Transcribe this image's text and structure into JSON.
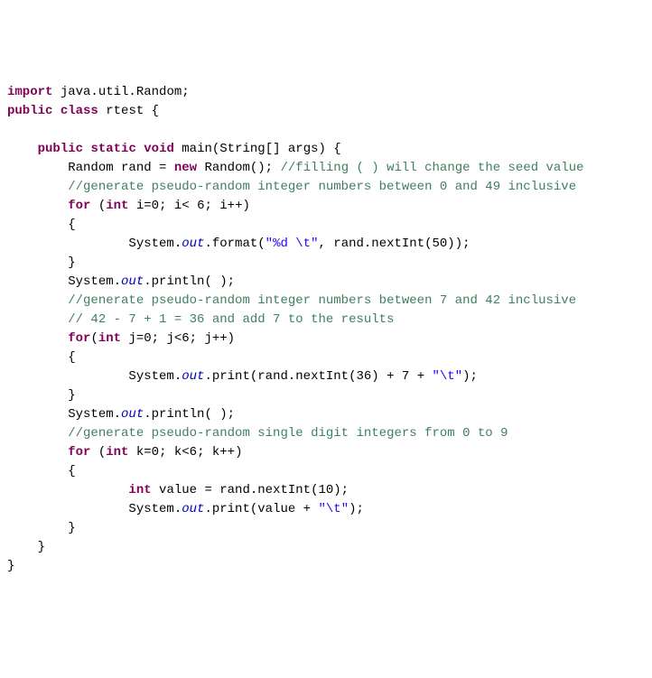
{
  "code": {
    "l1_import": "import",
    "l1_pkg": " java.util.Random;",
    "l2_public": "public",
    "l2_class": "class",
    "l2_name": " rtest {",
    "l4_public": "public",
    "l4_static": "static",
    "l4_void": "void",
    "l4_main": " main(String[] args) {",
    "l5_type": "Random rand = ",
    "l5_new": "new",
    "l5_rest": " Random(); ",
    "l5_cmt": "//filling ( ) will change the seed value",
    "l6_cmt": "//generate pseudo-random integer numbers between 0 and 49 inclusive",
    "l7_for": "for",
    "l7_rest": " (",
    "l7_int": "int",
    "l7_cond": " i=0; i< 6; i++)",
    "l8_brace": "{",
    "l9_sys": "System.",
    "l9_out": "out",
    "l9_format": ".format(",
    "l9_str": "\"%d \\t\"",
    "l9_rest": ", rand.nextInt(50));",
    "l10_brace": "}",
    "l11_sys": "System.",
    "l11_out": "out",
    "l11_println": ".println( );",
    "l12_cmt": "//generate pseudo-random integer numbers between 7 and 42 inclusive",
    "l13_cmt": "// 42 - 7 + 1 = 36 and add 7 to the results",
    "l14_for": "for",
    "l14_rest": "(",
    "l14_int": "int",
    "l14_cond": " j=0; j<6; j++)",
    "l15_brace": "{",
    "l16_sys": "System.",
    "l16_out": "out",
    "l16_print": ".print(rand.nextInt(36) + 7 + ",
    "l16_str": "\"\\t\"",
    "l16_end": ");",
    "l17_brace": "}",
    "l18_sys": "System.",
    "l18_out": "out",
    "l18_println": ".println( );",
    "l19_cmt": "//generate pseudo-random single digit integers from 0 to 9",
    "l20_for": "for",
    "l20_rest": " (",
    "l20_int": "int",
    "l20_cond": " k=0; k<6; k++)",
    "l21_brace": "{",
    "l22_int": "int",
    "l22_rest": " value = rand.nextInt(10);",
    "l23_sys": "System.",
    "l23_out": "out",
    "l23_print": ".print(value + ",
    "l23_str": "\"\\t\"",
    "l23_end": ");",
    "l24_brace": "}",
    "l25_brace": "}",
    "l26_brace": "}"
  }
}
